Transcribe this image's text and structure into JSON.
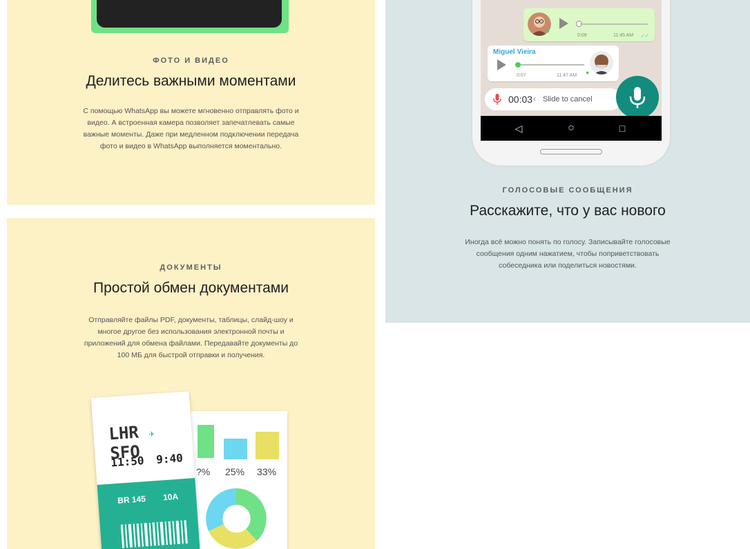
{
  "photo_section": {
    "eyebrow": "ФОТО И ВИДЕО",
    "heading": "Делитесь важными моментами",
    "lines": [
      "С помощью WhatsApp вы можете мгновенно отправлять фото и",
      "видео. А встроенная камера позволяет запечатлевать самые",
      "важные моменты. Даже при медленном подключении передача",
      "фото и видео в WhatsApp выполняется моментально."
    ]
  },
  "documents_section": {
    "eyebrow": "ДОКУМЕНТЫ",
    "heading": "Простой обмен документами",
    "lines": [
      "Отправляйте файлы PDF, документы, таблицы, слайд-шоу и",
      "многое другое без использования электронной почты и",
      "приложений для обмена файлами. Передавайте документы до",
      "100 МБ для быстрой отправки и получения."
    ],
    "ticket": {
      "from": "LHR",
      "to": "SFO",
      "depart": "11:50",
      "arrive": "9:40",
      "flight": "BR 145",
      "seat": "10A"
    },
    "chart_percents": [
      "?%",
      "25%",
      "33%"
    ]
  },
  "voice_section": {
    "eyebrow": "ГОЛОСОВЫЕ СООБЩЕНИЯ",
    "heading": "Расскажите, что у вас нового",
    "lines": [
      "Иногда всё можно понять по голосу. Записывайте голосовые",
      "сообщения одним нажатием, чтобы поприветствовать",
      "собеседника или поделиться новостями."
    ],
    "chat": {
      "out_duration": "0:09",
      "out_time": "11:45 AM",
      "in_sender": "Miguel Vieira",
      "in_duration": "0:07",
      "in_time": "11:47 AM",
      "record_timer": "00:03",
      "slide_hint": "Slide to cancel"
    },
    "nav": {
      "back": "◁",
      "home": "○",
      "recent": "□"
    }
  },
  "colors": {
    "yellow_card": "#fdf1c6",
    "blue_card": "#d9e5e7",
    "whatsapp_teal": "#128c7e",
    "bubble_green": "#dcf8c6"
  }
}
